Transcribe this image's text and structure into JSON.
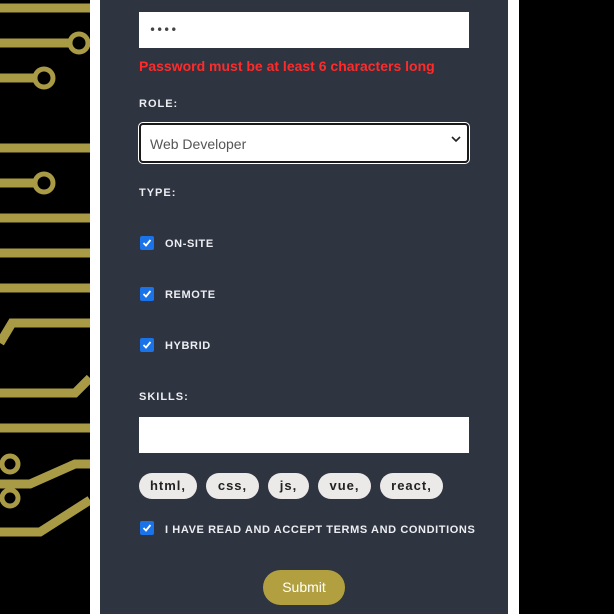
{
  "password": {
    "value": "••••",
    "error": "Password must be at least 6 characters long"
  },
  "role": {
    "label": "ROLE:",
    "selected": "Web Developer"
  },
  "type": {
    "label": "TYPE:",
    "options": [
      {
        "label": "ON-SITE",
        "checked": true
      },
      {
        "label": "REMOTE",
        "checked": true
      },
      {
        "label": "HYBRID",
        "checked": true
      }
    ]
  },
  "skills": {
    "label": "SKILLS:",
    "input_value": "",
    "tags": [
      "html,",
      "css,",
      "js,",
      "vue,",
      "react,"
    ]
  },
  "terms": {
    "label": "I HAVE READ AND ACCEPT TERMS AND CONDITIONS",
    "checked": true
  },
  "submit_label": "Submit",
  "colors": {
    "panel": "#2f3441",
    "accent_gold": "#b2a040",
    "error": "#ff2b2b",
    "checkbox": "#1a73e8",
    "circuit": "#a99a45"
  },
  "icons": {
    "select_caret": "chevron-down-icon",
    "checkbox_mark": "check-icon"
  }
}
